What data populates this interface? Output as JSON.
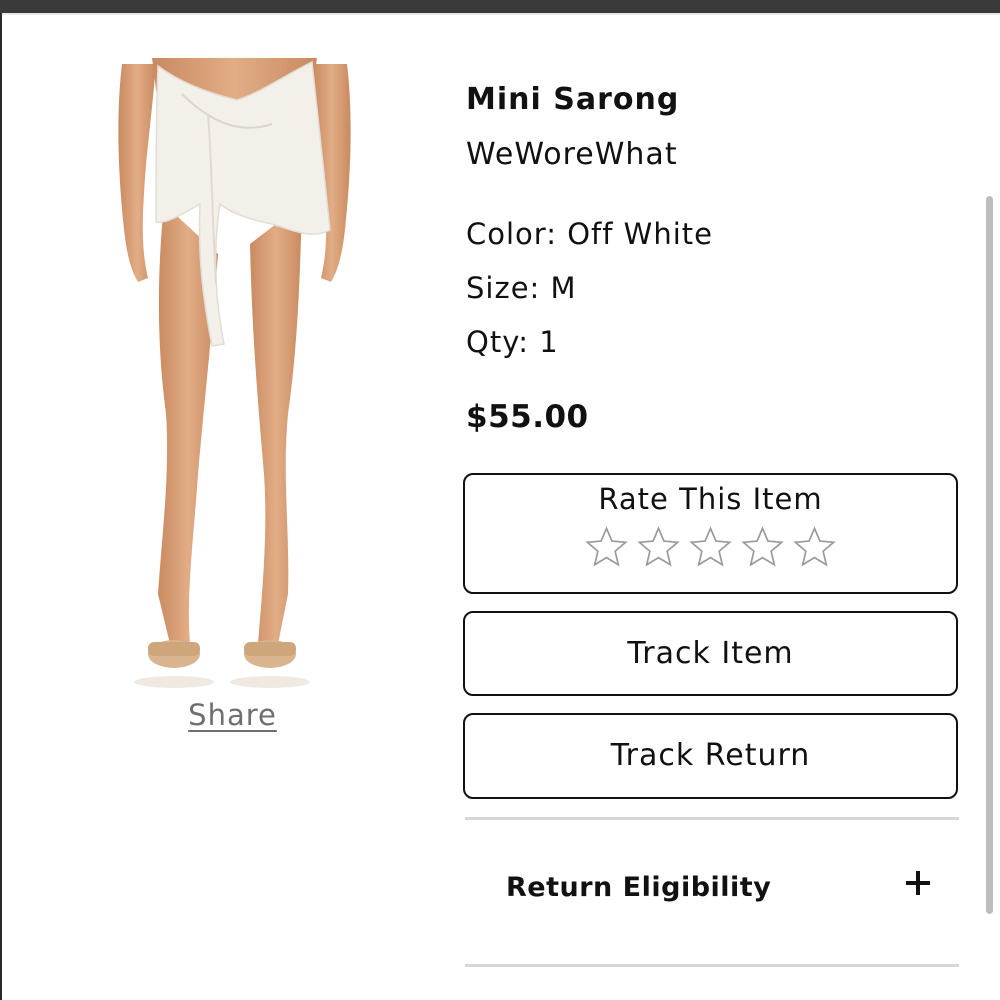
{
  "product": {
    "title": "Mini Sarong",
    "brand": "WeWoreWhat",
    "color_text": "Color: Off White",
    "size_text": "Size: M",
    "qty_text": "Qty: 1",
    "price": "$55.00",
    "image_icon": "product-photo"
  },
  "share": {
    "label": "Share"
  },
  "rating": {
    "label": "Rate This Item",
    "max_stars": 5,
    "current": 0,
    "star_icon": "star-outline-icon"
  },
  "actions": {
    "track_item": "Track Item",
    "track_return": "Track Return"
  },
  "return_section": {
    "label": "Return Eligibility",
    "expand_icon": "plus-icon"
  },
  "colors": {
    "text": "#111111",
    "muted": "#6f6f6f",
    "divider": "#d7d7d7",
    "top_bar": "#3a3a3a",
    "star_outline": "#9a9a9a",
    "skin": "#d9a27a",
    "garment": "#f3efe9"
  }
}
